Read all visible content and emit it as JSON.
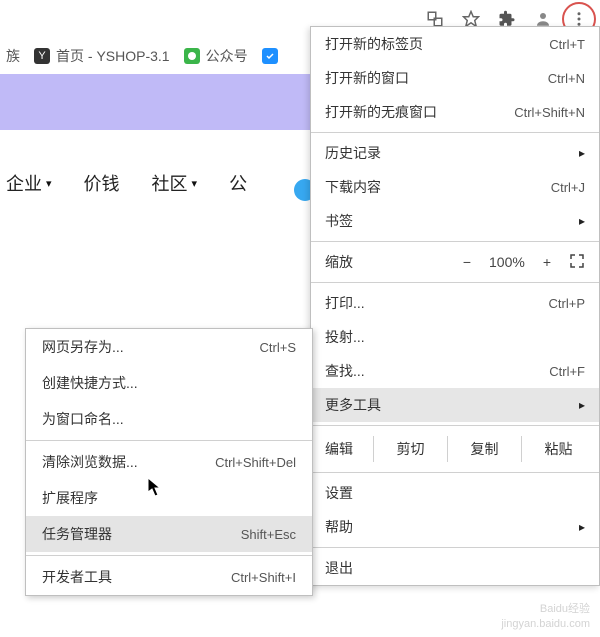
{
  "toolbar": {
    "translate": "translate-icon",
    "star": "star-icon",
    "ext": "extension-icon",
    "profile": "profile-icon",
    "menu": "menu-icon"
  },
  "tabs": {
    "tab1_suffix": "族",
    "tab2_favicon": "Y",
    "tab2_label": "首页 - YSHOP-3.1",
    "tab3_label": "公众号"
  },
  "nav": {
    "item1": "企业",
    "item2": "价钱",
    "item3": "社区",
    "item4": "公"
  },
  "menu": {
    "new_tab": "打开新的标签页",
    "new_tab_sc": "Ctrl+T",
    "new_window": "打开新的窗口",
    "new_window_sc": "Ctrl+N",
    "new_incognito": "打开新的无痕窗口",
    "new_incognito_sc": "Ctrl+Shift+N",
    "history": "历史记录",
    "downloads": "下载内容",
    "downloads_sc": "Ctrl+J",
    "bookmarks": "书签",
    "zoom_label": "缩放",
    "zoom_minus": "−",
    "zoom_val": "100%",
    "zoom_plus": "+",
    "print": "打印...",
    "print_sc": "Ctrl+P",
    "cast": "投射...",
    "find": "查找...",
    "find_sc": "Ctrl+F",
    "more_tools": "更多工具",
    "edit_label": "编辑",
    "cut": "剪切",
    "copy": "复制",
    "paste": "粘贴",
    "settings": "设置",
    "help": "帮助",
    "exit": "退出"
  },
  "submenu": {
    "save_as": "网页另存为...",
    "save_as_sc": "Ctrl+S",
    "create_shortcut": "创建快捷方式...",
    "name_window": "为窗口命名...",
    "clear_data": "清除浏览数据...",
    "clear_data_sc": "Ctrl+Shift+Del",
    "extensions": "扩展程序",
    "task_manager": "任务管理器",
    "task_manager_sc": "Shift+Esc",
    "dev_tools": "开发者工具",
    "dev_tools_sc": "Ctrl+Shift+I"
  },
  "watermark": {
    "line1": "Baidu经验",
    "line2": "jingyan.baidu.com"
  }
}
